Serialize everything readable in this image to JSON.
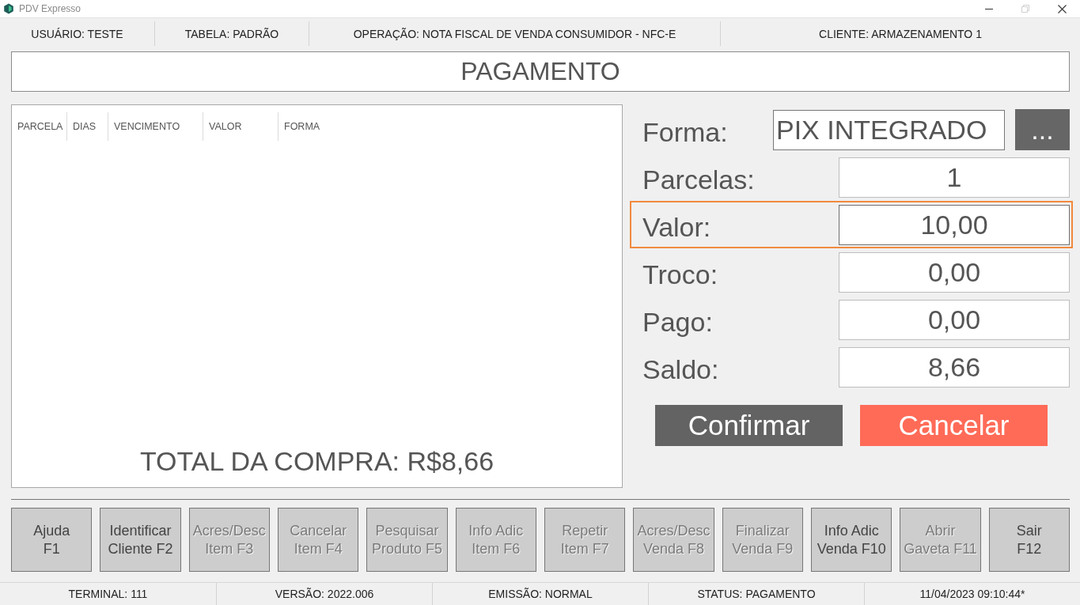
{
  "window": {
    "title": "PDV Expresso",
    "controls": [
      {
        "kind": "minimize",
        "disabled": false
      },
      {
        "kind": "restore",
        "disabled": true
      },
      {
        "kind": "close",
        "disabled": false
      }
    ]
  },
  "header": [
    "USUÁRIO: TESTE",
    "TABELA: PADRÃO",
    "OPERAÇÃO: NOTA FISCAL DE VENDA CONSUMIDOR - NFC-E",
    "CLIENTE: ARMAZENAMENTO 1"
  ],
  "page_title": "PAGAMENTO",
  "installments_table": {
    "columns": [
      "PARCELA",
      "DIAS",
      "VENCIMENTO",
      "VALOR",
      "FORMA"
    ]
  },
  "total": "TOTAL DA COMPRA: R$8,66",
  "payment": {
    "fields": [
      {
        "kind": "picker",
        "label": "Forma:",
        "value": "PIX INTEGRADO",
        "button": "...",
        "focused": false
      },
      {
        "kind": "number",
        "label": "Parcelas:",
        "value": "1",
        "focused": false
      },
      {
        "kind": "number",
        "label": "Valor:",
        "value": "10,00",
        "focused": true
      },
      {
        "kind": "number",
        "label": "Troco:",
        "value": "0,00",
        "focused": false
      },
      {
        "kind": "number",
        "label": "Pago:",
        "value": "0,00",
        "focused": false
      },
      {
        "kind": "number",
        "label": "Saldo:",
        "value": "8,66",
        "focused": false
      }
    ],
    "buttons": [
      {
        "kind": "confirm",
        "label": "Confirmar"
      },
      {
        "kind": "cancel",
        "label": "Cancelar"
      }
    ]
  },
  "function_keys": [
    {
      "label": "Ajuda\nF1",
      "disabled": false
    },
    {
      "label": "Identificar\nCliente F2",
      "disabled": false
    },
    {
      "label": "Acres/Desc\nItem F3",
      "disabled": true
    },
    {
      "label": "Cancelar\nItem F4",
      "disabled": true
    },
    {
      "label": "Pesquisar\nProduto F5",
      "disabled": true
    },
    {
      "label": "Info Adic\nItem F6",
      "disabled": true
    },
    {
      "label": "Repetir\nItem F7",
      "disabled": true
    },
    {
      "label": "Acres/Desc\nVenda F8",
      "disabled": true
    },
    {
      "label": "Finalizar\nVenda F9",
      "disabled": true
    },
    {
      "label": "Info Adic\nVenda F10",
      "disabled": false
    },
    {
      "label": "Abrir\nGaveta F11",
      "disabled": true
    },
    {
      "label": "Sair\nF12",
      "disabled": false
    }
  ],
  "status_bar": [
    "TERMINAL: 111",
    "VERSÃO: 2022.006",
    "EMISSÃO: NORMAL",
    "STATUS: PAGAMENTO",
    "11/04/2023 09:10:44*"
  ]
}
